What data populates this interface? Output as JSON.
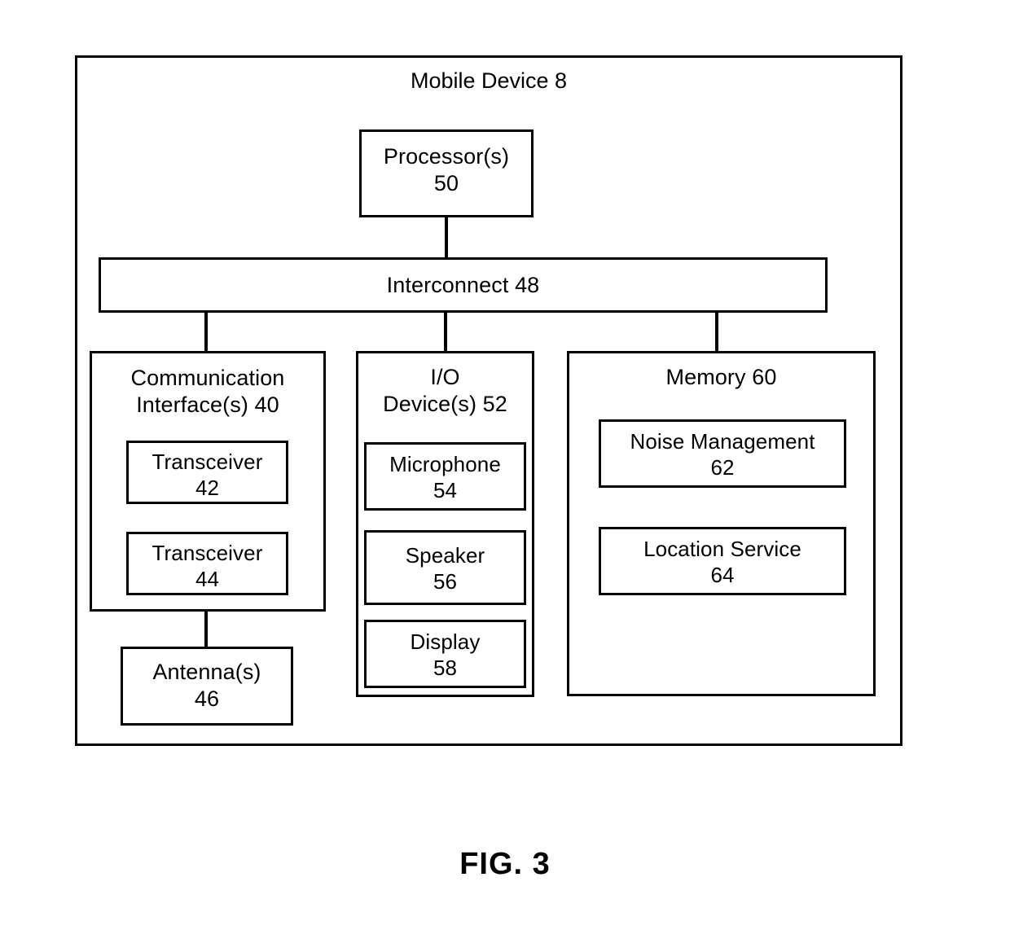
{
  "figure": {
    "caption": "FIG. 3",
    "title": "Mobile Device 8",
    "type": "block-diagram"
  },
  "diagram": {
    "outer_container": {
      "name": "Mobile Device",
      "label": "Mobile Device 8",
      "reference_numeral": "8"
    },
    "processor": {
      "label": "Processor(s)\n50",
      "name": "Processor(s)",
      "reference_numeral": "50"
    },
    "interconnect": {
      "label": "Interconnect 48",
      "name": "Interconnect",
      "reference_numeral": "48"
    },
    "communication_interface": {
      "label": "Communication\nInterface(s) 40",
      "name": "Communication Interface(s)",
      "reference_numeral": "40",
      "children": [
        {
          "label": "Transceiver\n42",
          "name": "Transceiver",
          "reference_numeral": "42"
        },
        {
          "label": "Transceiver\n44",
          "name": "Transceiver",
          "reference_numeral": "44"
        }
      ]
    },
    "antenna": {
      "label": "Antenna(s)\n46",
      "name": "Antenna(s)",
      "reference_numeral": "46"
    },
    "io_devices": {
      "label": "I/O\nDevice(s) 52",
      "name": "I/O Device(s)",
      "reference_numeral": "52",
      "children": [
        {
          "label": "Microphone\n54",
          "name": "Microphone",
          "reference_numeral": "54"
        },
        {
          "label": "Speaker\n56",
          "name": "Speaker",
          "reference_numeral": "56"
        },
        {
          "label": "Display\n58",
          "name": "Display",
          "reference_numeral": "58"
        }
      ]
    },
    "memory": {
      "label": "Memory 60",
      "name": "Memory",
      "reference_numeral": "60",
      "children": [
        {
          "label": "Noise Management\n62",
          "name": "Noise Management",
          "reference_numeral": "62"
        },
        {
          "label": "Location Service\n64",
          "name": "Location Service",
          "reference_numeral": "64"
        }
      ]
    },
    "connections": [
      {
        "from": "Processor(s) 50",
        "to": "Interconnect 48"
      },
      {
        "from": "Interconnect 48",
        "to": "Communication Interface(s) 40"
      },
      {
        "from": "Interconnect 48",
        "to": "I/O Device(s) 52"
      },
      {
        "from": "Interconnect 48",
        "to": "Memory 60"
      },
      {
        "from": "Communication Interface(s) 40",
        "to": "Antenna(s) 46"
      }
    ]
  },
  "colors": {
    "stroke": "#000000",
    "background": "#ffffff",
    "text": "#000000"
  }
}
